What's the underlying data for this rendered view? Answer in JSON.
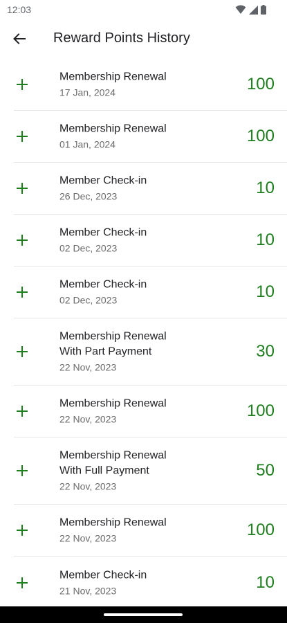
{
  "status_bar": {
    "time": "12:03",
    "icons": [
      "wifi-icon",
      "cellular-signal-icon",
      "battery-icon"
    ]
  },
  "app_bar": {
    "back_icon": "arrow-left-icon",
    "title": "Reward Points History"
  },
  "colors": {
    "points": "#1e7e1e",
    "divider": "#e6e6e6",
    "date_text": "#6b6b6b"
  },
  "transactions": [
    {
      "title": "Membership Renewal",
      "date": "17 Jan, 2024",
      "points": "100"
    },
    {
      "title": "Membership Renewal",
      "date": "01 Jan, 2024",
      "points": "100"
    },
    {
      "title": "Member Check-in",
      "date": "26 Dec, 2023",
      "points": "10"
    },
    {
      "title": "Member Check-in",
      "date": "02 Dec, 2023",
      "points": "10"
    },
    {
      "title": "Member Check-in",
      "date": "02 Dec, 2023",
      "points": "10"
    },
    {
      "title": "Membership Renewal\nWith Part Payment",
      "date": "22 Nov, 2023",
      "points": "30"
    },
    {
      "title": "Membership Renewal",
      "date": "22 Nov, 2023",
      "points": "100"
    },
    {
      "title": "Membership Renewal\nWith Full Payment",
      "date": "22 Nov, 2023",
      "points": "50"
    },
    {
      "title": "Membership Renewal",
      "date": "22 Nov, 2023",
      "points": "100"
    },
    {
      "title": "Member Check-in",
      "date": "21 Nov, 2023",
      "points": "10"
    }
  ]
}
